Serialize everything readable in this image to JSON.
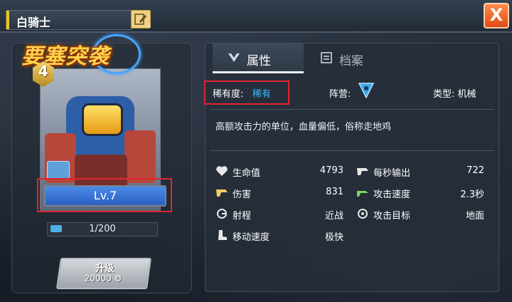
{
  "window": {
    "title": "白骑士",
    "edit_count": "0",
    "close_label": "X"
  },
  "hero": {
    "logo_text": "要塞突袭",
    "star_level": "4",
    "level_text": "Lv.7",
    "exp_text": "1/200",
    "upgrade_label": "升级",
    "upgrade_cost": "20000"
  },
  "tabs": [
    {
      "label": "属性",
      "icon": "attribute-icon",
      "active": true
    },
    {
      "label": "档案",
      "icon": "archive-icon",
      "active": false
    }
  ],
  "info": {
    "rarity_label": "稀有度:",
    "rarity_value": "稀有",
    "faction_label": "阵营:",
    "type_label": "类型: 机械",
    "description": "高额攻击力的单位，血量偏低，俗称走地鸡"
  },
  "stats": [
    {
      "label": "生命值",
      "value": "4793",
      "icon": "heart-icon"
    },
    {
      "label": "每秒输出",
      "value": "722",
      "icon": "dps-icon"
    },
    {
      "label": "伤害",
      "value": "831",
      "icon": "damage-icon"
    },
    {
      "label": "攻击速度",
      "value": "2.3秒",
      "icon": "attack-speed-icon"
    },
    {
      "label": "射程",
      "value": "近战",
      "icon": "range-icon"
    },
    {
      "label": "攻击目标",
      "value": "地面",
      "icon": "target-icon"
    },
    {
      "label": "移动速度",
      "value": "极快",
      "icon": "boot-icon"
    }
  ],
  "colors": {
    "accent": "#f2c21b",
    "highlight_box": "#e0262e",
    "rarity": "#3fb8ff"
  }
}
